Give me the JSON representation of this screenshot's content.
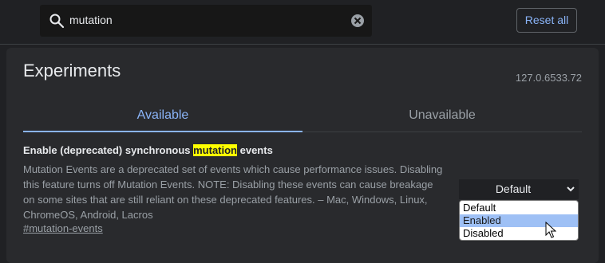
{
  "search": {
    "value": "mutation",
    "icon": "search-icon",
    "clear_icon": "clear-icon"
  },
  "header": {
    "reset_label": "Reset all"
  },
  "page": {
    "title": "Experiments",
    "version": "127.0.6533.72"
  },
  "tabs": [
    {
      "label": "Available",
      "active": true
    },
    {
      "label": "Unavailable",
      "active": false
    }
  ],
  "experiment": {
    "title_before": "Enable (deprecated) synchronous ",
    "title_highlight": "mutation",
    "title_after": " events",
    "description": "Mutation Events are a deprecated set of events which cause performance issues. Disabling this feature turns off Mutation Events. NOTE: Disabling these events can cause breakage on some sites that are still reliant on these deprecated features. – Mac, Windows, Linux, ChromeOS, Android, Lacros",
    "link": "#mutation-events",
    "select_value": "Default",
    "options": [
      "Default",
      "Enabled",
      "Disabled"
    ],
    "highlighted_option": "Enabled"
  },
  "colors": {
    "accent": "#8ab4f8",
    "background": "#202124",
    "panel": "#292a2d",
    "highlight": "#ffff00"
  }
}
